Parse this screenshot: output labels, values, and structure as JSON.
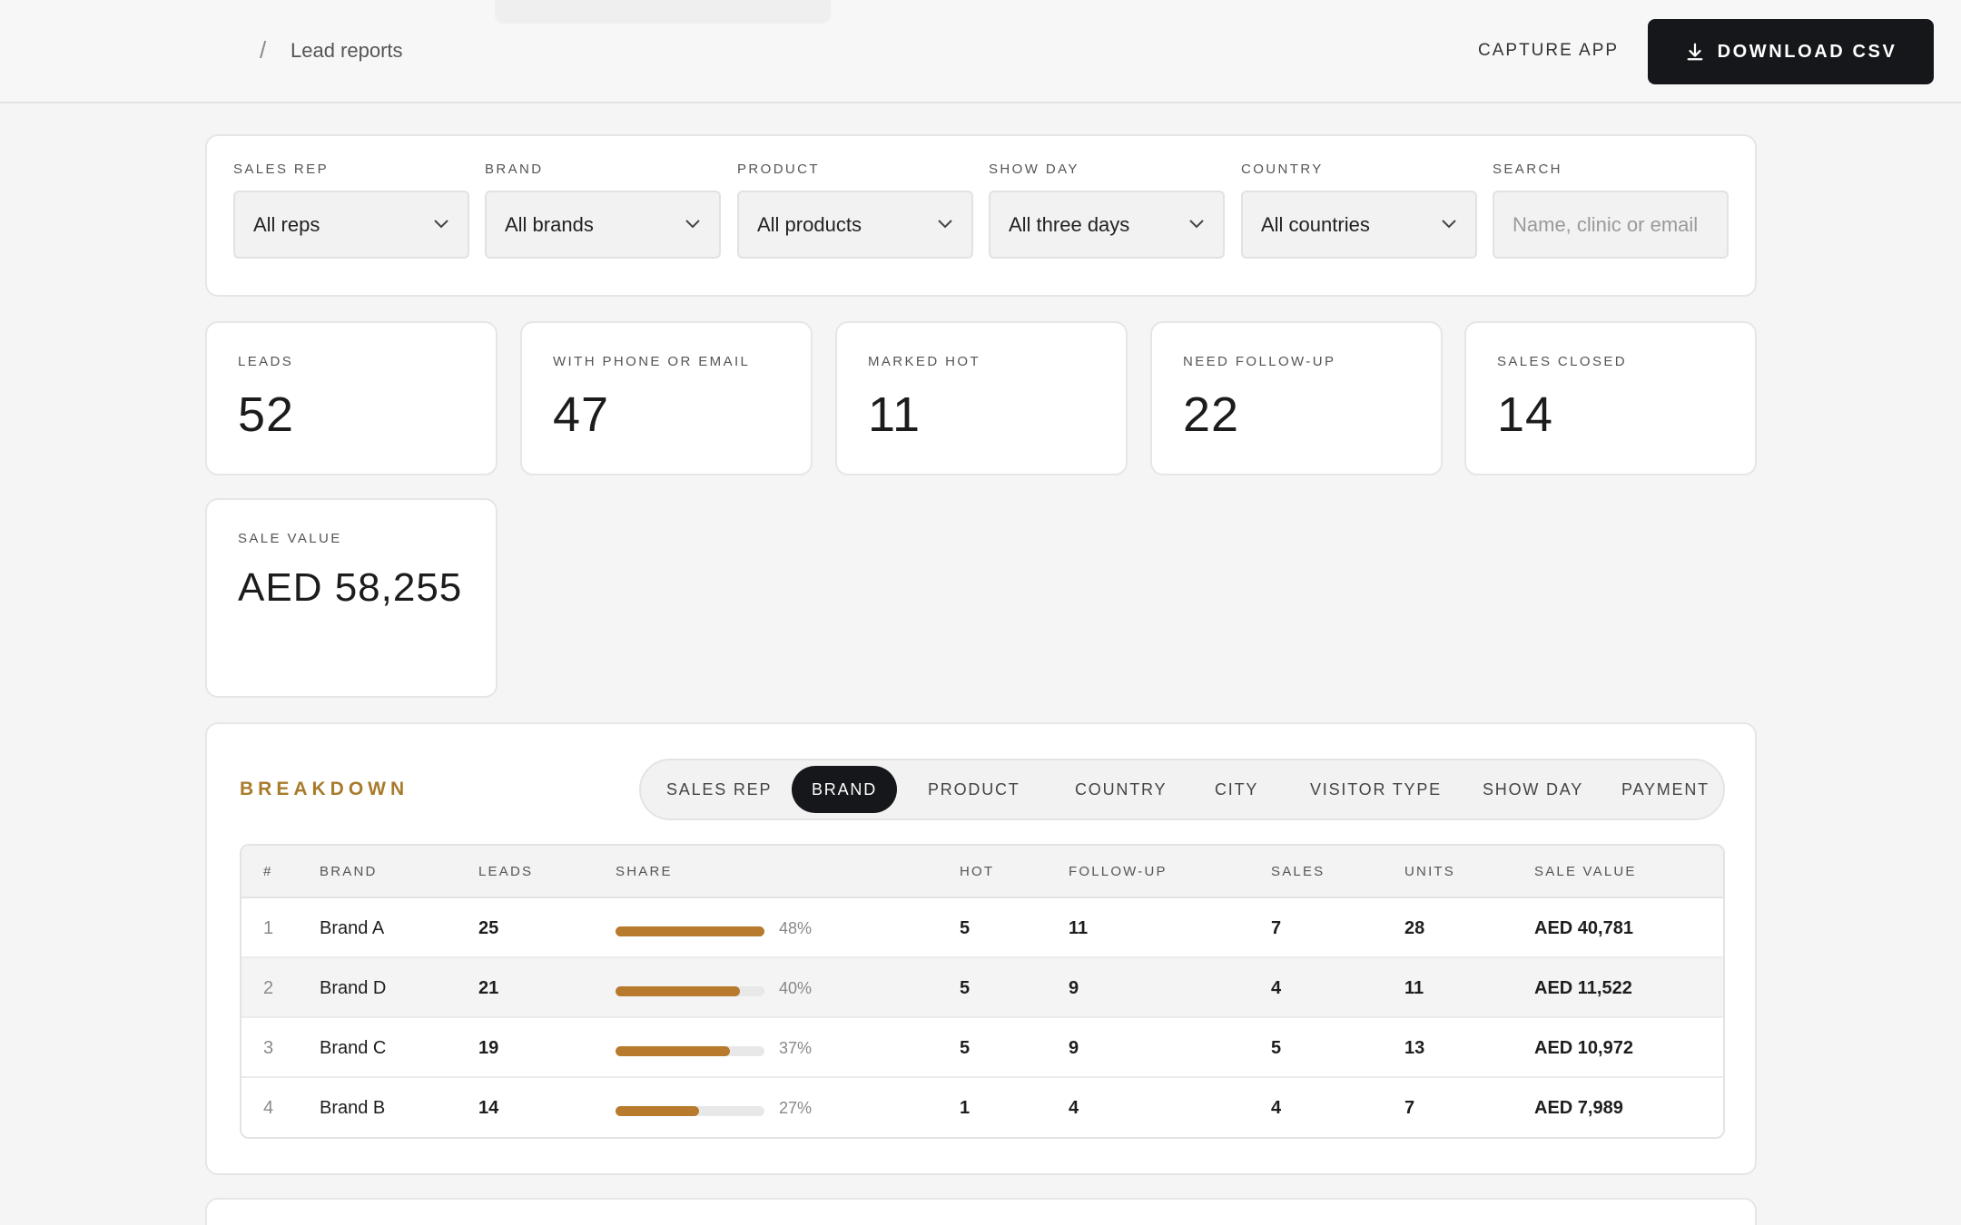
{
  "header": {
    "breadcrumb_sep": "/",
    "breadcrumb_label": "Lead reports",
    "capture_link": "CAPTURE APP",
    "download_label": "DOWNLOAD CSV"
  },
  "filters": [
    {
      "label": "SALES REP",
      "value": "All reps"
    },
    {
      "label": "BRAND",
      "value": "All brands"
    },
    {
      "label": "PRODUCT",
      "value": "All products"
    },
    {
      "label": "SHOW DAY",
      "value": "All three days"
    },
    {
      "label": "COUNTRY",
      "value": "All countries"
    }
  ],
  "search": {
    "label": "SEARCH",
    "placeholder": "Name, clinic or email"
  },
  "stats": [
    {
      "label": "LEADS",
      "value": "52"
    },
    {
      "label": "WITH PHONE OR EMAIL",
      "value": "47"
    },
    {
      "label": "MARKED HOT",
      "value": "11"
    },
    {
      "label": "NEED FOLLOW-UP",
      "value": "22"
    },
    {
      "label": "SALES CLOSED",
      "value": "14"
    }
  ],
  "sale_value": {
    "label": "SALE VALUE",
    "value": "AED 58,255"
  },
  "breakdown": {
    "title": "BREAKDOWN",
    "tabs": [
      "SALES REP",
      "BRAND",
      "PRODUCT",
      "COUNTRY",
      "CITY",
      "VISITOR TYPE",
      "SHOW DAY",
      "PAYMENT"
    ],
    "active_tab": "BRAND",
    "columns": [
      "#",
      "BRAND",
      "LEADS",
      "SHARE",
      "HOT",
      "FOLLOW-UP",
      "SALES",
      "UNITS",
      "SALE VALUE"
    ],
    "rows": [
      {
        "idx": "1",
        "brand": "Brand A",
        "leads": "25",
        "share": 48,
        "share_label": "48%",
        "hot": "5",
        "followup": "11",
        "sales": "7",
        "units": "28",
        "value": "AED 40,781"
      },
      {
        "idx": "2",
        "brand": "Brand D",
        "leads": "21",
        "share": 40,
        "share_label": "40%",
        "hot": "5",
        "followup": "9",
        "sales": "4",
        "units": "11",
        "value": "AED 11,522"
      },
      {
        "idx": "3",
        "brand": "Brand C",
        "leads": "19",
        "share": 37,
        "share_label": "37%",
        "hot": "5",
        "followup": "9",
        "sales": "5",
        "units": "13",
        "value": "AED 10,972"
      },
      {
        "idx": "4",
        "brand": "Brand B",
        "leads": "14",
        "share": 27,
        "share_label": "27%",
        "hot": "1",
        "followup": "4",
        "sales": "4",
        "units": "7",
        "value": "AED 7,989"
      }
    ]
  },
  "colors": {
    "accent": "#b87a2d",
    "title_gold": "#a87b2c",
    "dark": "#15171a"
  }
}
